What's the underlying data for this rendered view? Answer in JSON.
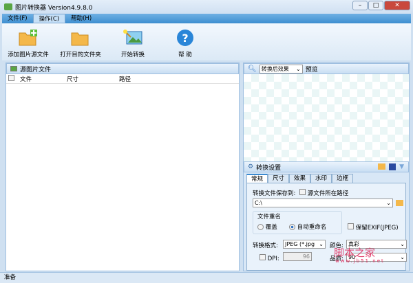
{
  "window": {
    "title": "图片转换器 Version4.9.8.0",
    "minimize": "–",
    "maximize": "□",
    "close": "✕"
  },
  "menu": [
    {
      "label": "文件(F)"
    },
    {
      "label": "操作(C)"
    },
    {
      "label": "帮助(H)"
    }
  ],
  "toolbar": [
    {
      "label": "添加图片源文件",
      "icon": "folder-add-icon"
    },
    {
      "label": "打开目的文件夹",
      "icon": "folder-icon"
    },
    {
      "label": "开始转换",
      "icon": "magic-wand-image-icon"
    },
    {
      "label": "帮 助",
      "icon": "help-icon"
    }
  ],
  "source": {
    "title": "源图片文件",
    "columns": [
      "文件",
      "尺寸",
      "路径"
    ]
  },
  "preview": {
    "mode": "转换后效果",
    "label": "预览"
  },
  "settings": {
    "title": "转换设置",
    "tabs": [
      "常规",
      "尺寸",
      "效果",
      "水印",
      "边框"
    ],
    "save_to_label": "转换文件保存到:",
    "source_path_label": "源文件所在路径",
    "path": "C:\\",
    "rename_label": "文件重名",
    "overwrite": "覆盖",
    "auto_rename": "自动重命名",
    "keep_exif": "保留EXIF(JPEG)",
    "format_label": "转换格式:",
    "format": "JPEG (*.jpg",
    "color_label": "颜色:",
    "color": "真彩",
    "dpi_label": "DPI:",
    "dpi": "96",
    "quality_label": "品质:",
    "quality": "90"
  },
  "status": "准备",
  "watermark": {
    "text": "脚本之家",
    "url": "www.jb51.net"
  }
}
